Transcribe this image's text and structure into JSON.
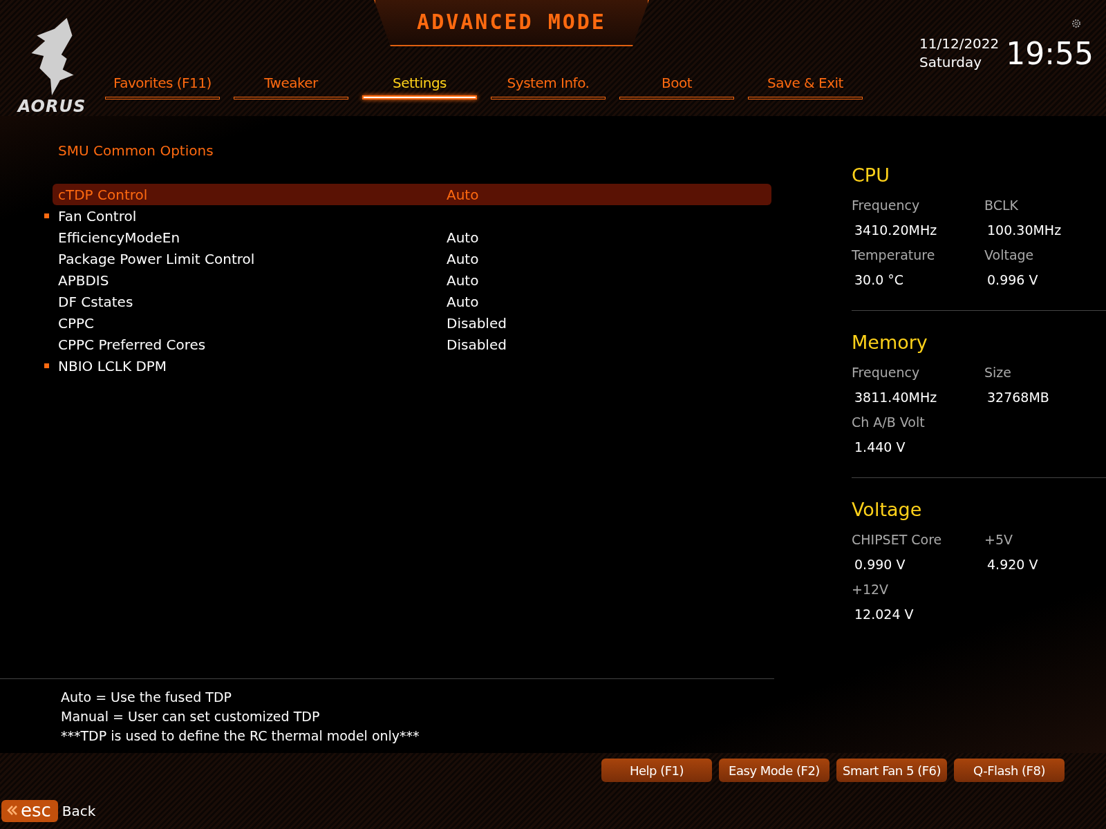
{
  "header": {
    "title": "ADVANCED MODE",
    "logo_text": "AORUS",
    "date": "11/12/2022",
    "weekday": "Saturday",
    "time": "19:55"
  },
  "tabs": [
    {
      "label": "Favorites (F11)",
      "selected": false
    },
    {
      "label": "Tweaker",
      "selected": false
    },
    {
      "label": "Settings",
      "selected": true
    },
    {
      "label": "System Info.",
      "selected": false
    },
    {
      "label": "Boot",
      "selected": false
    },
    {
      "label": "Save & Exit",
      "selected": false
    }
  ],
  "section_title": "SMU Common Options",
  "settings": [
    {
      "kind": "option",
      "label": "cTDP Control",
      "value": "Auto",
      "selected": true
    },
    {
      "kind": "submenu",
      "label": "Fan Control",
      "selected": false
    },
    {
      "kind": "option",
      "label": "EfficiencyModeEn",
      "value": "Auto",
      "selected": false
    },
    {
      "kind": "option",
      "label": "Package Power Limit Control",
      "value": "Auto",
      "selected": false
    },
    {
      "kind": "option",
      "label": "APBDIS",
      "value": "Auto",
      "selected": false
    },
    {
      "kind": "option",
      "label": "DF Cstates",
      "value": "Auto",
      "selected": false
    },
    {
      "kind": "option",
      "label": "CPPC",
      "value": "Disabled",
      "selected": false
    },
    {
      "kind": "option",
      "label": "CPPC Preferred Cores",
      "value": "Disabled",
      "selected": false
    },
    {
      "kind": "submenu",
      "label": "NBIO LCLK DPM",
      "selected": false
    }
  ],
  "help_lines": [
    "Auto = Use the fused TDP",
    "Manual = User can set customized TDP",
    "***TDP is used to define the RC thermal model only***"
  ],
  "monitor": [
    {
      "title": "CPU",
      "fields": [
        {
          "label": "Frequency",
          "value": "3410.20MHz"
        },
        {
          "label": "BCLK",
          "value": "100.30MHz"
        },
        {
          "label": "Temperature",
          "value": "30.0 °C"
        },
        {
          "label": "Voltage",
          "value": "0.996 V"
        }
      ]
    },
    {
      "title": "Memory",
      "fields": [
        {
          "label": "Frequency",
          "value": "3811.40MHz"
        },
        {
          "label": "Size",
          "value": "32768MB"
        },
        {
          "label": "Ch A/B Volt",
          "value": "1.440 V"
        }
      ]
    },
    {
      "title": "Voltage",
      "fields": [
        {
          "label": "CHIPSET Core",
          "value": "0.990 V"
        },
        {
          "label": "+5V",
          "value": "4.920 V"
        },
        {
          "label": "+12V",
          "value": "12.024 V"
        }
      ]
    }
  ],
  "footer": {
    "esc_key": "esc",
    "back_label": "Back",
    "buttons": [
      "Help (F1)",
      "Easy Mode (F2)",
      "Smart Fan 5 (F6)",
      "Q-Flash (F8)"
    ]
  }
}
